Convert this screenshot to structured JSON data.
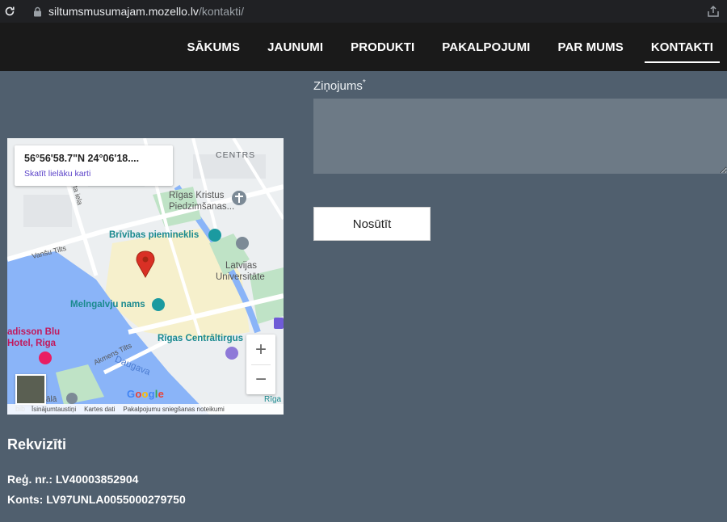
{
  "browser": {
    "url_host": "siltumsmusumajam.mozello.lv",
    "url_path": "/kontakti/"
  },
  "nav": {
    "items": [
      {
        "label": "SĀKUMS"
      },
      {
        "label": "JAUNUMI"
      },
      {
        "label": "PRODUKTI"
      },
      {
        "label": "PAKALPOJUMI"
      },
      {
        "label": "PAR MUMS"
      },
      {
        "label": "KONTAKTI"
      }
    ],
    "active": "KONTAKTI"
  },
  "form": {
    "message_label": "Ziņojums",
    "required_mark": "*",
    "submit_label": "Nosūtīt"
  },
  "map": {
    "coords": "56°56'58.7\"N 24°06'18....",
    "view_larger": "Skatīt lielāku karti",
    "labels": {
      "centrs": "CENTRS",
      "church_1": "Rīgas Kristus",
      "church_2": "Piedzimšanas...",
      "monument": "Brīvības piemineklis",
      "university_1": "Latvijas",
      "university_2": "Universitāte",
      "melngalvju": "Melngalvju nams",
      "radisson_1": "adisson Blu",
      "radisson_2": "Hotel, Riga",
      "market": "Rīgas Centrāltirgus",
      "daugava": "Daugava",
      "vansu": "Vanšu Tilts",
      "akmens": "Akmens Tilts",
      "krasta": "orta iela",
      "riga_short": "Rīga",
      "zala": "ālā",
      "bib": "bib"
    },
    "attribution": [
      "Īsinājumtaustiņi",
      "Kartes dati",
      "Pakalpojumu sniegšanas noteikumi"
    ],
    "zoom_in": "+",
    "zoom_out": "−",
    "logo": "Google"
  },
  "rekviziti": {
    "title": "Rekvizīti",
    "reg_nr": "Reģ. nr.: LV40003852904",
    "konts": "Konts: LV97UNLA0055000279750"
  },
  "colors": {
    "page_bg": "#505f6e",
    "nav_bg": "#1a1a1a",
    "input_bg": "#6d7a86",
    "map_pin": "#d93025",
    "poi_teal": "#1b9aa0"
  }
}
